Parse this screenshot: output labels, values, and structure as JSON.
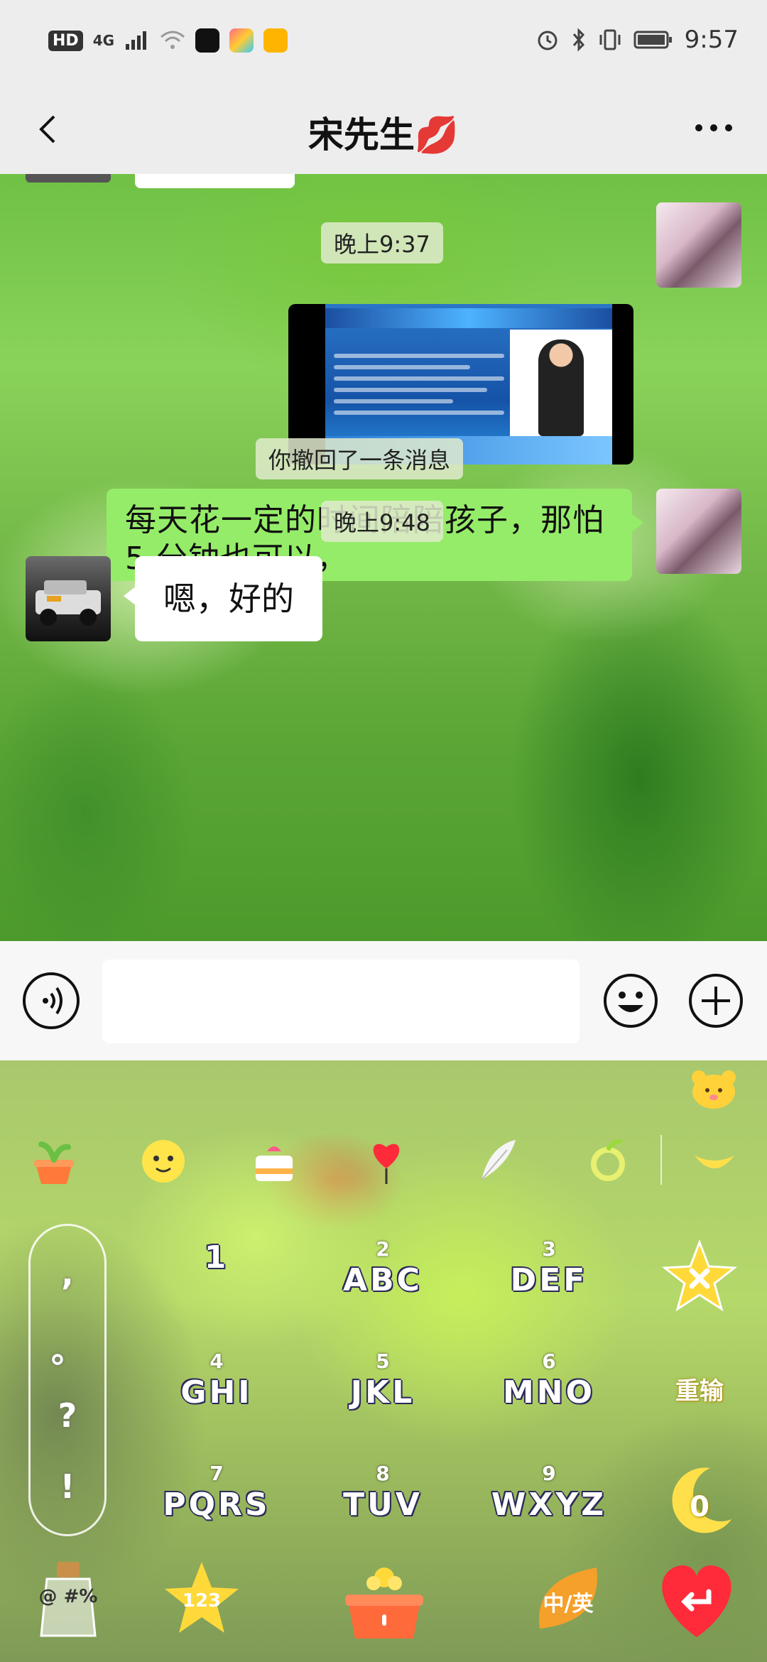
{
  "status_bar": {
    "hd": "HD",
    "network": "4G",
    "time": "9:57"
  },
  "header": {
    "title": "宋先生💋"
  },
  "chat": {
    "timestamp_1": "晚上9:37",
    "message_text": "每天花一定的时间陪陪孩子，那怕 5 分钟也可以，",
    "recall_notice": "你撤回了一条消息",
    "timestamp_2": "晚上9:48",
    "reply_text": "嗯，好的"
  },
  "keyboard": {
    "punctuation": [
      ",",
      "。",
      "?",
      "!"
    ],
    "keys": [
      {
        "num": "",
        "letters": "1"
      },
      {
        "num": "2",
        "letters": "ABC"
      },
      {
        "num": "3",
        "letters": "DEF"
      },
      {
        "num": "4",
        "letters": "GHI"
      },
      {
        "num": "5",
        "letters": "JKL"
      },
      {
        "num": "6",
        "letters": "MNO"
      },
      {
        "num": "7",
        "letters": "PQRS"
      },
      {
        "num": "8",
        "letters": "TUV"
      },
      {
        "num": "9",
        "letters": "WXYZ"
      }
    ],
    "retype_label": "重输",
    "zero_label": "0",
    "symbols_label": "@ #%",
    "numbers_label": "123",
    "lang_label": "中/英"
  },
  "colors": {
    "sent_bubble": "#95ec69",
    "received_bubble": "#ffffff",
    "chrome_bg": "#ededed"
  }
}
